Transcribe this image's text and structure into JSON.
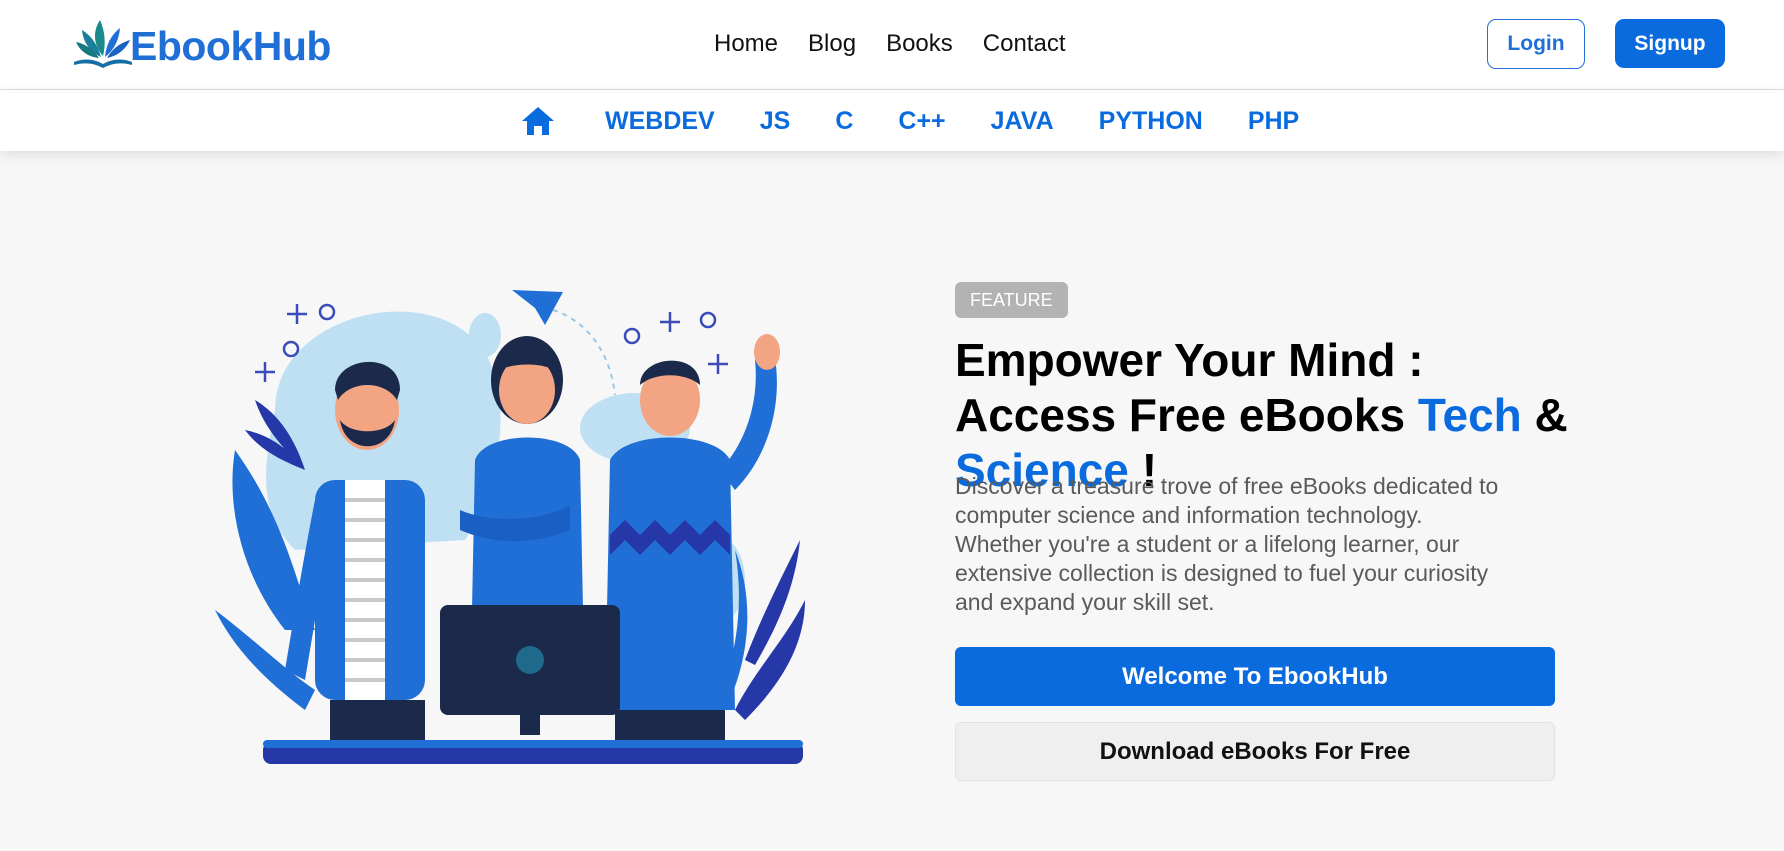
{
  "brand": {
    "name": "EbookHub",
    "logo_icon": "leaf-book-icon"
  },
  "nav": [
    {
      "label": "Home"
    },
    {
      "label": "Blog"
    },
    {
      "label": "Books"
    },
    {
      "label": "Contact"
    }
  ],
  "auth": {
    "login_label": "Login",
    "signup_label": "Signup"
  },
  "categories": {
    "home_icon": "home-icon",
    "items": [
      {
        "label": "WEBDEV"
      },
      {
        "label": "JS"
      },
      {
        "label": "C"
      },
      {
        "label": "C++"
      },
      {
        "label": "JAVA"
      },
      {
        "label": "PYTHON"
      },
      {
        "label": "PHP"
      }
    ]
  },
  "hero": {
    "badge": "FEATURE",
    "headline_part1": "Empower Your Mind : Access Free eBooks",
    "headline_accent1": "Tech",
    "headline_amp": "&",
    "headline_accent2": "Science",
    "headline_end": "!",
    "description": "Discover a treasure trove of free eBooks dedicated to computer science and information technology. Whether you're a student or a lifelong learner, our extensive collection is designed to fuel your curiosity and expand your skill set.",
    "primary_button": "Welcome To EbookHub",
    "secondary_button": "Download eBooks For Free"
  },
  "colors": {
    "accent": "#0a6bdf",
    "brand_text": "#1f6fd6",
    "badge_bg": "#b3b3b3",
    "page_bg": "#f7f7f7"
  }
}
